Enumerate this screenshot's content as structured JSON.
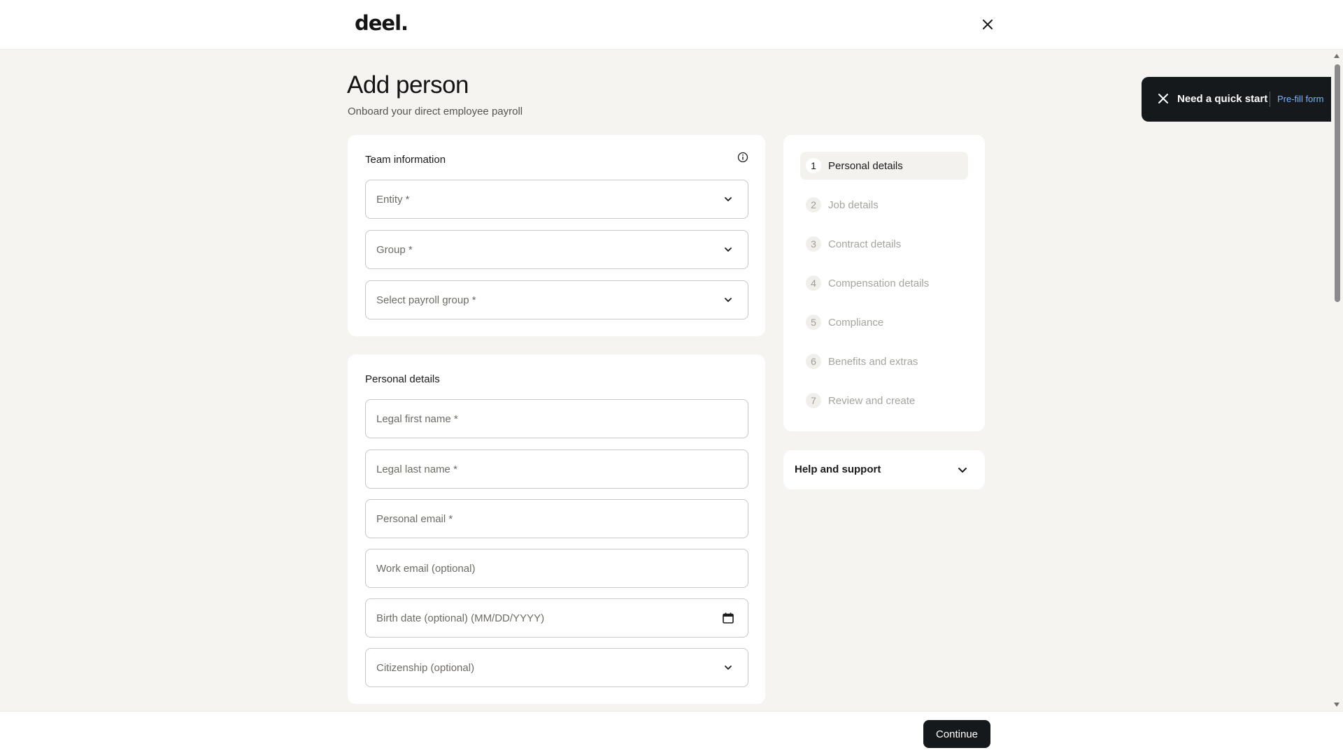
{
  "header": {
    "logo_text": "deel.",
    "close_icon": "close-icon"
  },
  "page": {
    "title": "Add person",
    "subtitle": "Onboard your direct employee payroll"
  },
  "team_information": {
    "title": "Team information",
    "info_icon": "info-icon",
    "fields": [
      {
        "label": "Entity *",
        "type": "select",
        "icon": "chevron-down-icon"
      },
      {
        "label": "Group *",
        "type": "select",
        "icon": "chevron-down-icon"
      },
      {
        "label": "Select payroll group *",
        "type": "select",
        "icon": "chevron-down-icon"
      }
    ]
  },
  "personal_details": {
    "title": "Personal details",
    "fields": [
      {
        "label": "Legal first name *",
        "type": "text"
      },
      {
        "label": "Legal last name *",
        "type": "text"
      },
      {
        "label": "Personal email *",
        "type": "text"
      },
      {
        "label": "Work email (optional)",
        "type": "text"
      },
      {
        "label": "Birth date (optional) (MM/DD/YYYY)",
        "type": "date",
        "icon": "calendar-icon"
      },
      {
        "label": "Citizenship (optional)",
        "type": "select",
        "icon": "chevron-down-icon"
      }
    ]
  },
  "stepper": {
    "steps": [
      {
        "number": "1",
        "label": "Personal details",
        "active": true
      },
      {
        "number": "2",
        "label": "Job details",
        "active": false
      },
      {
        "number": "3",
        "label": "Contract details",
        "active": false
      },
      {
        "number": "4",
        "label": "Compensation details",
        "active": false
      },
      {
        "number": "5",
        "label": "Compliance",
        "active": false
      },
      {
        "number": "6",
        "label": "Benefits and extras",
        "active": false
      },
      {
        "number": "7",
        "label": "Review and create",
        "active": false
      }
    ]
  },
  "help": {
    "label": "Help and support",
    "icon": "chevron-down-icon"
  },
  "toast": {
    "message": "Need a quick start",
    "link": "Pre-fill form",
    "close_icon": "close-icon"
  },
  "footer": {
    "continue_label": "Continue"
  },
  "colors": {
    "background": "#f5f4f1",
    "card": "#ffffff",
    "primary_button": "#16191b",
    "link": "#7fb2ff"
  }
}
